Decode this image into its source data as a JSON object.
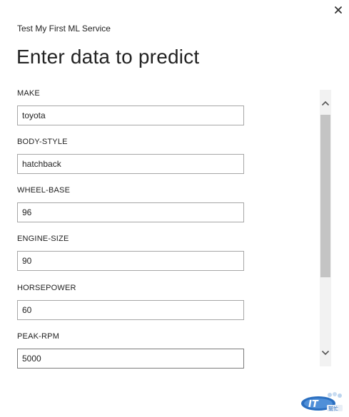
{
  "dialog": {
    "subtitle": "Test My First ML Service",
    "title": "Enter data to predict",
    "close_icon": "close-icon"
  },
  "fields": [
    {
      "label": "MAKE",
      "value": "toyota"
    },
    {
      "label": "BODY-STYLE",
      "value": "hatchback"
    },
    {
      "label": "WHEEL-BASE",
      "value": "96"
    },
    {
      "label": "ENGINE-SIZE",
      "value": "90"
    },
    {
      "label": "HORSEPOWER",
      "value": "60"
    },
    {
      "label": "PEAK-RPM",
      "value": "5000"
    }
  ],
  "scrollbar": {
    "up_icon": "chevron-up-icon",
    "down_icon": "chevron-down-icon"
  },
  "watermark": {
    "icon": "ithome-logo-icon",
    "text": "IT邦幫忙"
  },
  "colors": {
    "background": "#ffffff",
    "text": "#222222",
    "input_border": "#a6a6a6",
    "scroll_track": "#f2f2f2",
    "scroll_thumb": "#c4c4c4"
  }
}
